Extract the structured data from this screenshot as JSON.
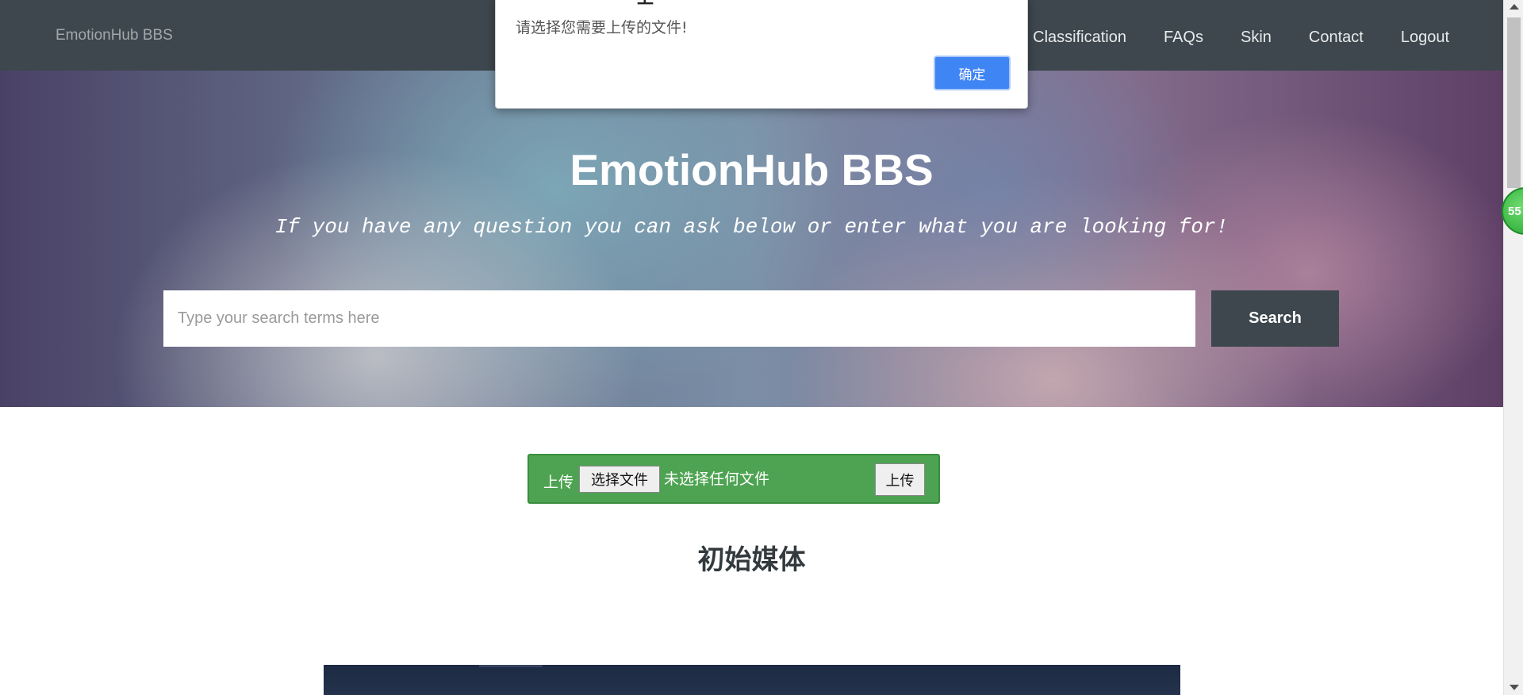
{
  "navbar": {
    "brand": "EmotionHub BBS",
    "links": [
      {
        "label": "n Classification"
      },
      {
        "label": "FAQs"
      },
      {
        "label": "Skin"
      },
      {
        "label": "Contact"
      },
      {
        "label": "Logout"
      }
    ]
  },
  "hero": {
    "title": "EmotionHub BBS",
    "subtitle": "If you have any question you can ask below or enter what you are looking for!",
    "search_placeholder": "Type your search terms here",
    "search_button": "Search"
  },
  "upload": {
    "label": "上传",
    "choose_button": "选择文件",
    "file_status": "未选择任何文件",
    "submit_button": "上传"
  },
  "section": {
    "heading": "初始媒体"
  },
  "float_badge": {
    "value": "55"
  },
  "alert": {
    "title_fragment": "上",
    "message": "请选择您需要上传的文件!",
    "ok_button": "确定"
  },
  "colors": {
    "navbar_bg": "#3d474d",
    "upload_bg": "#4ea352",
    "alert_button": "#3f85f4"
  }
}
